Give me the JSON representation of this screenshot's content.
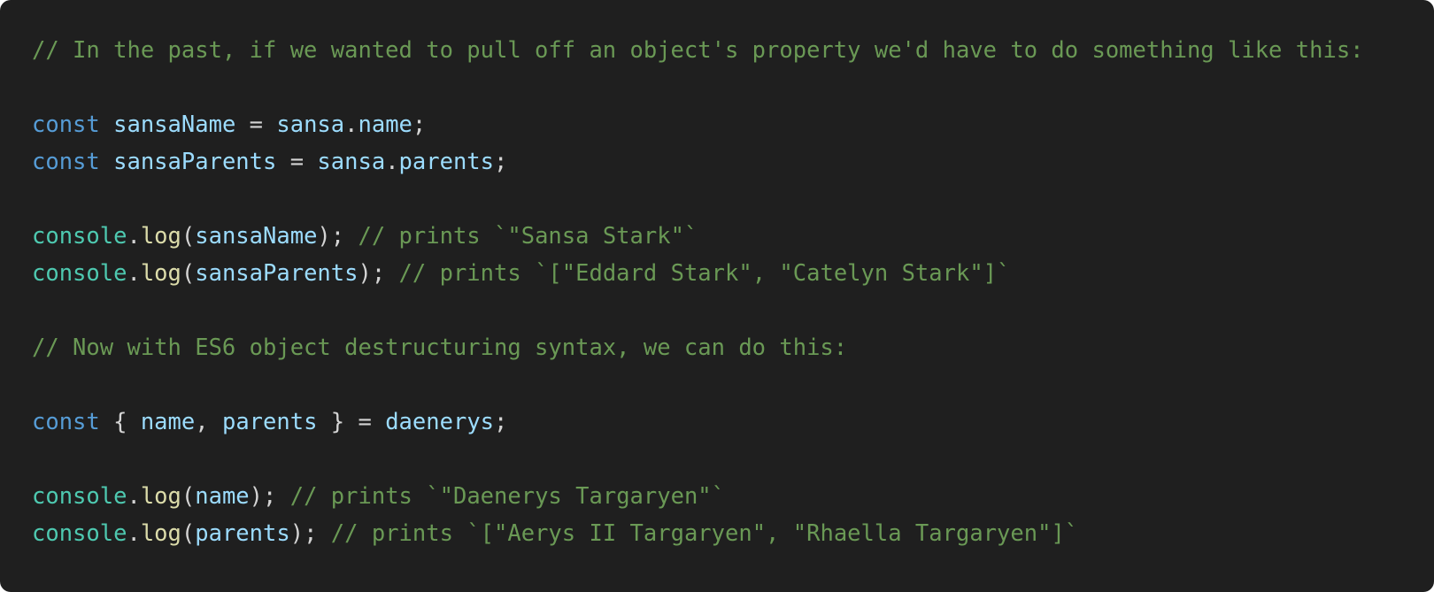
{
  "code_lines": [
    [
      {
        "text": "// In the past, if we wanted to pull off an object's property we'd have to do something like this:",
        "type": "comment"
      }
    ],
    [],
    [
      {
        "text": "const",
        "type": "keyword"
      },
      {
        "text": " ",
        "type": "punct"
      },
      {
        "text": "sansaName",
        "type": "variable"
      },
      {
        "text": " = ",
        "type": "punct"
      },
      {
        "text": "sansa",
        "type": "variable"
      },
      {
        "text": ".",
        "type": "punct"
      },
      {
        "text": "name",
        "type": "variable"
      },
      {
        "text": ";",
        "type": "punct"
      }
    ],
    [
      {
        "text": "const",
        "type": "keyword"
      },
      {
        "text": " ",
        "type": "punct"
      },
      {
        "text": "sansaParents",
        "type": "variable"
      },
      {
        "text": " = ",
        "type": "punct"
      },
      {
        "text": "sansa",
        "type": "variable"
      },
      {
        "text": ".",
        "type": "punct"
      },
      {
        "text": "parents",
        "type": "variable"
      },
      {
        "text": ";",
        "type": "punct"
      }
    ],
    [],
    [
      {
        "text": "console",
        "type": "object"
      },
      {
        "text": ".",
        "type": "punct"
      },
      {
        "text": "log",
        "type": "method"
      },
      {
        "text": "(",
        "type": "punct"
      },
      {
        "text": "sansaName",
        "type": "variable"
      },
      {
        "text": "); ",
        "type": "punct"
      },
      {
        "text": "// prints `\"Sansa Stark\"`",
        "type": "comment"
      }
    ],
    [
      {
        "text": "console",
        "type": "object"
      },
      {
        "text": ".",
        "type": "punct"
      },
      {
        "text": "log",
        "type": "method"
      },
      {
        "text": "(",
        "type": "punct"
      },
      {
        "text": "sansaParents",
        "type": "variable"
      },
      {
        "text": "); ",
        "type": "punct"
      },
      {
        "text": "// prints `[\"Eddard Stark\", \"Catelyn Stark\"]`",
        "type": "comment"
      }
    ],
    [],
    [
      {
        "text": "// Now with ES6 object destructuring syntax, we can do this:",
        "type": "comment"
      }
    ],
    [],
    [
      {
        "text": "const",
        "type": "keyword"
      },
      {
        "text": " { ",
        "type": "punct"
      },
      {
        "text": "name",
        "type": "variable"
      },
      {
        "text": ", ",
        "type": "punct"
      },
      {
        "text": "parents",
        "type": "variable"
      },
      {
        "text": " } = ",
        "type": "punct"
      },
      {
        "text": "daenerys",
        "type": "variable"
      },
      {
        "text": ";",
        "type": "punct"
      }
    ],
    [],
    [
      {
        "text": "console",
        "type": "object"
      },
      {
        "text": ".",
        "type": "punct"
      },
      {
        "text": "log",
        "type": "method"
      },
      {
        "text": "(",
        "type": "punct"
      },
      {
        "text": "name",
        "type": "variable"
      },
      {
        "text": "); ",
        "type": "punct"
      },
      {
        "text": "// prints `\"Daenerys Targaryen\"`",
        "type": "comment"
      }
    ],
    [
      {
        "text": "console",
        "type": "object"
      },
      {
        "text": ".",
        "type": "punct"
      },
      {
        "text": "log",
        "type": "method"
      },
      {
        "text": "(",
        "type": "punct"
      },
      {
        "text": "parents",
        "type": "variable"
      },
      {
        "text": "); ",
        "type": "punct"
      },
      {
        "text": "// prints `[\"Aerys II Targaryen\", \"Rhaella Targaryen\"]`",
        "type": "comment"
      }
    ]
  ],
  "colors": {
    "background": "#1f1f1f",
    "comment": "#6a9955",
    "keyword": "#569cd6",
    "variable": "#9cdcfe",
    "object": "#4ec9b0",
    "method": "#dcdcaa",
    "punct": "#d4d4d4"
  }
}
